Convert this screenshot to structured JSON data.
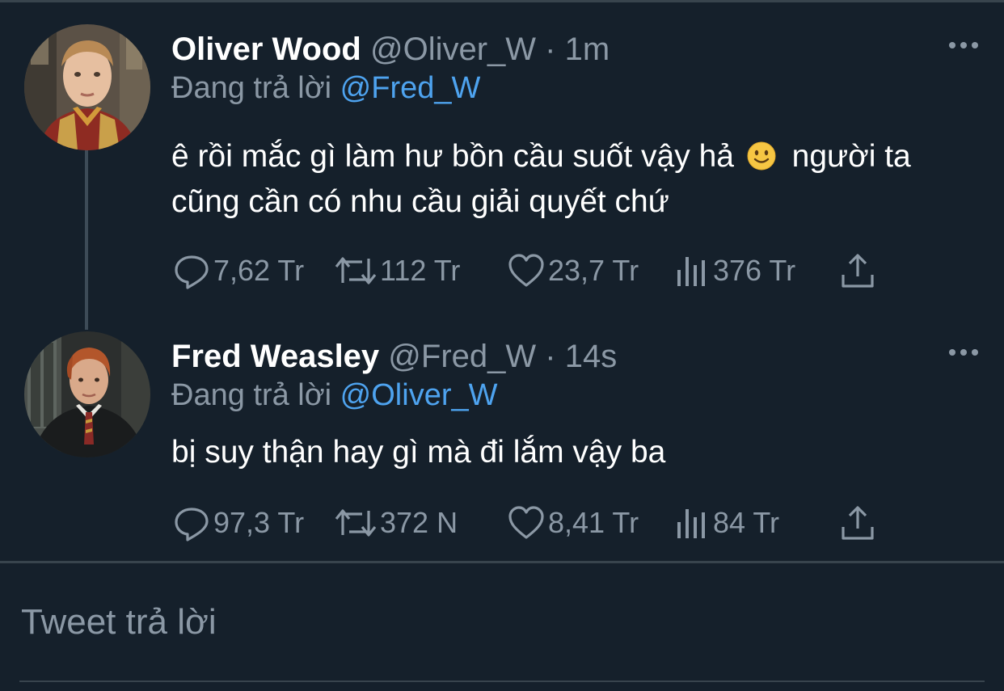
{
  "colors": {
    "background": "#15202b",
    "primary_text": "#ffffff",
    "secondary_text": "#8b98a5",
    "mention": "#4ea3ef",
    "divider": "#38444d"
  },
  "tweets": [
    {
      "name": "Oliver Wood",
      "handle": "@Oliver_W",
      "separator": "·",
      "time": "1m",
      "replying_prefix": "Đang trả lời",
      "replying_to": "@Fred_W",
      "text_before_emoji": "ê rồi mắc gì làm hư bồn cầu suốt vậy hả",
      "emoji": "slightly-smiling-face",
      "text_after_emoji": "người ta cũng cần có nhu cầu giải quyết chứ",
      "stats": {
        "replies": "7,62 Tr",
        "retweets": "112 Tr",
        "likes": "23,7 Tr",
        "views": "376 Tr"
      }
    },
    {
      "name": "Fred Weasley",
      "handle": "@Fred_W",
      "separator": "·",
      "time": "14s",
      "replying_prefix": "Đang trả lời",
      "replying_to": "@Oliver_W",
      "text": "bị suy thận hay gì mà đi lắm vậy ba",
      "stats": {
        "replies": "97,3 Tr",
        "retweets": "372 N",
        "likes": "8,41 Tr",
        "views": "84 Tr"
      }
    }
  ],
  "compose": {
    "placeholder": "Tweet trả lời"
  },
  "icons": {
    "reply": "reply-icon",
    "retweet": "retweet-icon",
    "like": "heart-icon",
    "views": "views-icon",
    "share": "share-icon",
    "more": "more-icon"
  }
}
